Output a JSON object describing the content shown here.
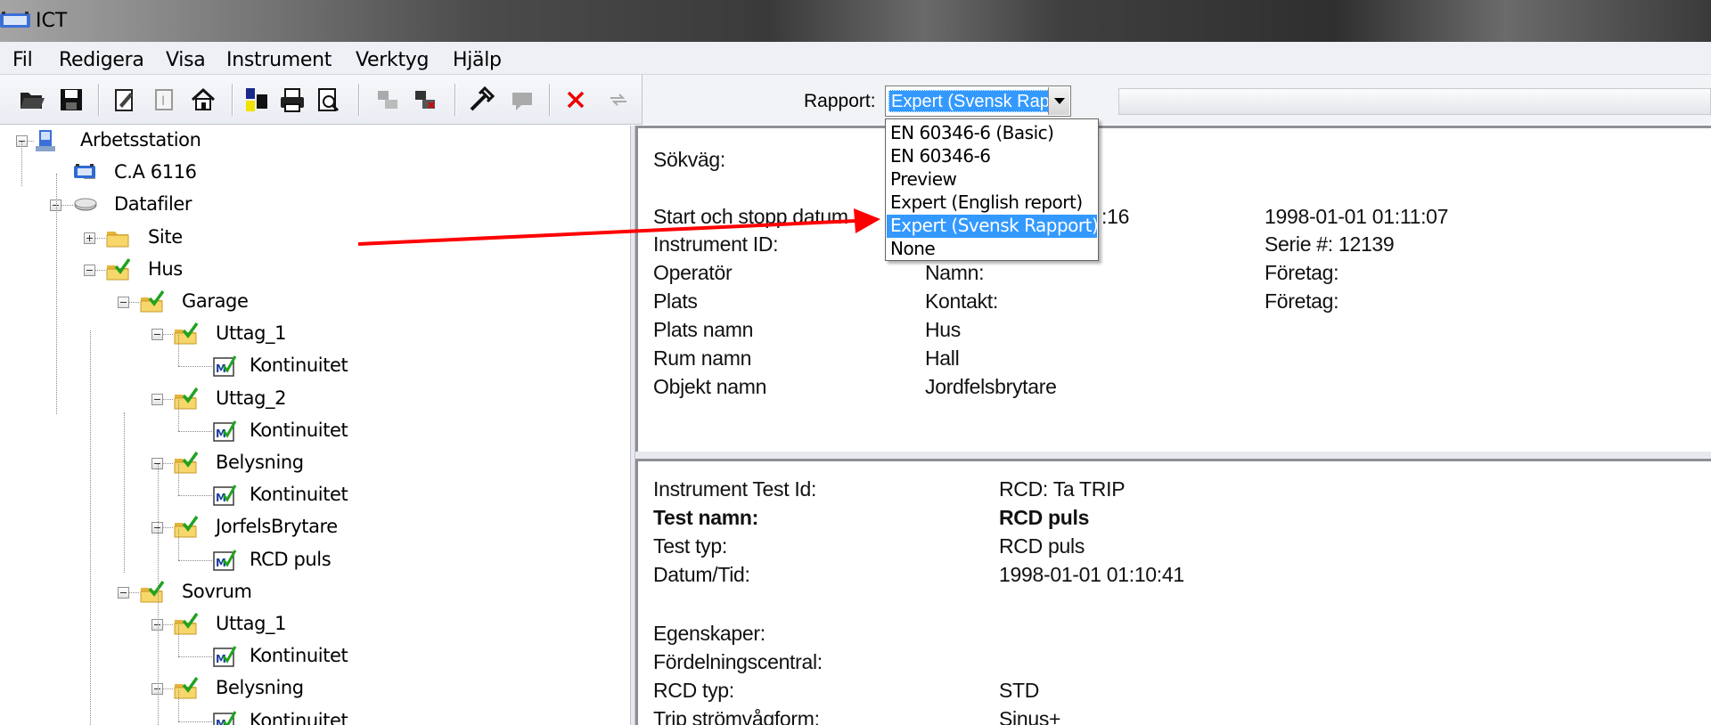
{
  "window": {
    "title": "ICT"
  },
  "menu": [
    "Fil",
    "Redigera",
    "Visa",
    "Instrument",
    "Verktyg",
    "Hjälp"
  ],
  "toolbar": {
    "rapport_label": "Rapport:",
    "rapport_value": "Expert (Svensk Rap",
    "rapport_options": [
      "EN 60346-6 (Basic)",
      "EN 60346-6",
      "Preview",
      "Expert (English report)",
      "Expert (Svensk Rapport)",
      "None"
    ],
    "selected_index": 4
  },
  "tree": {
    "nodes": [
      {
        "label": "Arbetsstation",
        "icon": "workstation-icon"
      },
      {
        "label": "C.A 6116",
        "icon": "instrument-icon"
      },
      {
        "label": "Datafiler",
        "icon": "drive-icon"
      },
      {
        "label": "Site",
        "icon": "folder-icon"
      },
      {
        "label": "Hus",
        "icon": "folder-checked-icon"
      },
      {
        "label": "Garage",
        "icon": "folder-checked-icon"
      },
      {
        "label": "Uttag_1",
        "icon": "folder-checked-icon"
      },
      {
        "label": "Kontinuitet",
        "icon": "measurement-icon"
      },
      {
        "label": "Uttag_2",
        "icon": "folder-checked-icon"
      },
      {
        "label": "Kontinuitet",
        "icon": "measurement-icon"
      },
      {
        "label": "Belysning",
        "icon": "folder-checked-icon"
      },
      {
        "label": "Kontinuitet",
        "icon": "measurement-icon"
      },
      {
        "label": "JorfelsBrytare",
        "icon": "folder-checked-icon"
      },
      {
        "label": "RCD puls",
        "icon": "measurement-icon"
      },
      {
        "label": "Sovrum",
        "icon": "folder-checked-icon"
      },
      {
        "label": "Uttag_1",
        "icon": "folder-checked-icon"
      },
      {
        "label": "Kontinuitet",
        "icon": "measurement-icon"
      },
      {
        "label": "Belysning",
        "icon": "folder-checked-icon"
      },
      {
        "label": "Kontinuitet",
        "icon": "measurement-icon"
      }
    ]
  },
  "info": {
    "sokvag_label": "Sökväg:",
    "start_label": "Start och stopp datum",
    "start_value": ":16",
    "stop_value": "1998-01-01 01:11:07",
    "instrument_id_label": "Instrument ID:",
    "serie_label": "Serie #: 12139",
    "operator_label": "Operatör",
    "namn_label": "Namn:",
    "foretag1": "Företag:",
    "plats_label": "Plats",
    "kontakt_label": "Kontakt:",
    "foretag2": "Företag:",
    "plats_namn_label": "Plats namn",
    "plats_namn_value": "Hus",
    "rum_namn_label": "Rum namn",
    "rum_namn_value": "Hall",
    "objekt_namn_label": "Objekt namn",
    "objekt_namn_value": "Jordfelsbrytare"
  },
  "test": {
    "instrument_test_id_label": "Instrument Test Id:",
    "instrument_test_id_value": "RCD: Ta TRIP",
    "test_namn_label": "Test namn:",
    "test_namn_value": "RCD puls",
    "test_typ_label": "Test typ:",
    "test_typ_value": "RCD puls",
    "datum_label": "Datum/Tid:",
    "datum_value": "1998-01-01 01:10:41",
    "egenskaper_label": "Egenskaper:",
    "fordelning_label": "Fördelningscentral:",
    "rcd_typ_label": "RCD typ:",
    "rcd_typ_value": "STD",
    "trip_label": "Trip strömvågform:",
    "trip_value": "Sinus+"
  },
  "colors": {
    "selection": "#3399ff",
    "arrow": "#ff0000",
    "folder": "#f5c542",
    "check": "#2aa52a"
  }
}
